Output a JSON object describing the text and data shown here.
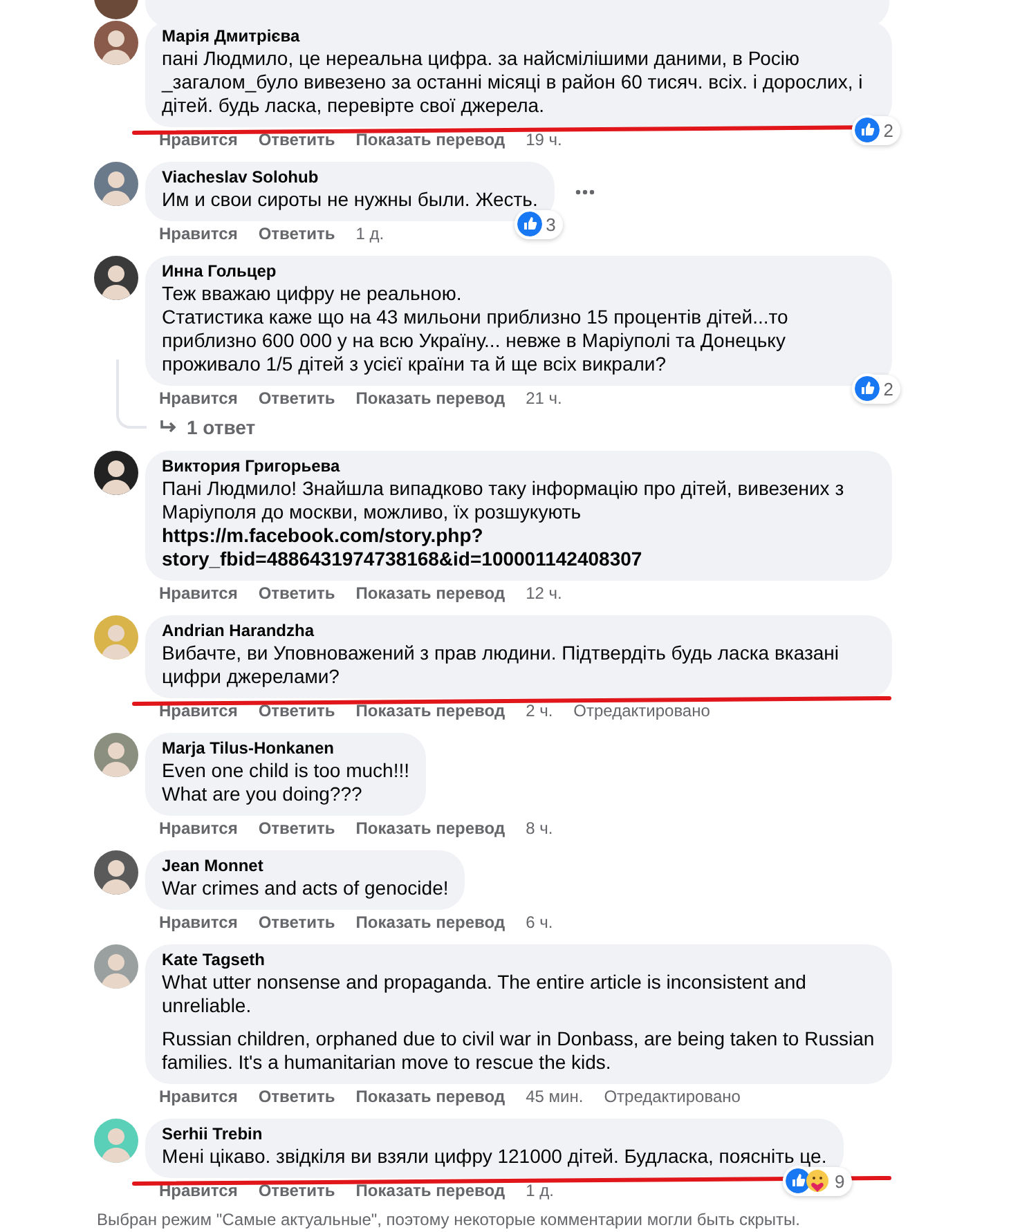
{
  "comments": [
    {
      "author": "Марія Дмитрієва",
      "paragraphs": [
        {
          "kind": "text",
          "text": "пані Людмило, це нереальна цифра. за найсмілішими даними, в Росію _загалом_було вивезено за останні місяці в район 60 тисяч. всіх. і дорослих, і дітей. будь ласка, перевірте свої джерела."
        }
      ],
      "actions": {
        "like": "Нравится",
        "reply": "Ответить",
        "translate": "Показать перевод",
        "time": "19 ч."
      },
      "reactions": {
        "icons": [
          {
            "kind": "like"
          }
        ],
        "count": "2"
      },
      "underlined": true,
      "more_button": false
    },
    {
      "author": "Viacheslav Solohub",
      "paragraphs": [
        {
          "kind": "text",
          "text": "Им и свои сироты не нужны были. Жесть."
        }
      ],
      "actions": {
        "like": "Нравится",
        "reply": "Ответить",
        "time": "1 д."
      },
      "reactions": {
        "icons": [
          {
            "kind": "like"
          }
        ],
        "count": "3"
      },
      "underlined": false,
      "more_button": true
    },
    {
      "author": "Инна Гольцер",
      "paragraphs": [
        {
          "kind": "text",
          "text": "Теж вважаю цифру не реальною."
        },
        {
          "kind": "text",
          "text": "Статистика каже що на 43 мильони приблизно 15 процентів дітей...то приблизно 600 000 у на всю Україну... невже в Маріуполі та Донецьку проживало 1/5 дітей з усієї країни та й ще всіх викрали?"
        }
      ],
      "actions": {
        "like": "Нравится",
        "reply": "Ответить",
        "translate": "Показать перевод",
        "time": "21 ч."
      },
      "reactions": {
        "icons": [
          {
            "kind": "like"
          }
        ],
        "count": "2"
      },
      "replies": "1 ответ",
      "underlined": false,
      "more_button": false
    },
    {
      "author": "Виктория Григорьева",
      "paragraphs": [
        {
          "kind": "text",
          "text": "Пані Людмило! Знайшла випадково таку інформацію про дітей, вивезених з Маріуполя до москви, можливо, їх розшукують"
        },
        {
          "kind": "link",
          "lines": [
            "https://m.facebook.com/story.php?",
            "story_fbid=4886431974738168&id=100001142408307"
          ]
        }
      ],
      "actions": {
        "like": "Нравится",
        "reply": "Ответить",
        "translate": "Показать перевод",
        "time": "12 ч."
      },
      "underlined": false,
      "more_button": false
    },
    {
      "author": "Andrian Harandzha",
      "paragraphs": [
        {
          "kind": "text",
          "text": "Вибачте, ви Уповноважений з прав людини. Підтвердіть будь ласка вказані цифри джерелами?"
        }
      ],
      "actions": {
        "like": "Нравится",
        "reply": "Ответить",
        "translate": "Показать перевод",
        "time": "2 ч.",
        "edited": "Отредактировано"
      },
      "underlined": true,
      "more_button": false
    },
    {
      "author": "Marja Tilus-Honkanen",
      "paragraphs": [
        {
          "kind": "text",
          "text": "Even one child is too much!!!"
        },
        {
          "kind": "text",
          "text": "What are you doing???"
        }
      ],
      "actions": {
        "like": "Нравится",
        "reply": "Ответить",
        "translate": "Показать перевод",
        "time": "8 ч."
      },
      "underlined": false,
      "more_button": false
    },
    {
      "author": "Jean Monnet",
      "paragraphs": [
        {
          "kind": "text",
          "text": "War crimes and acts of genocide!"
        }
      ],
      "actions": {
        "like": "Нравится",
        "reply": "Ответить",
        "translate": "Показать перевод",
        "time": "6 ч."
      },
      "underlined": false,
      "more_button": false
    },
    {
      "author": "Kate Tagseth",
      "paragraphs": [
        {
          "kind": "text",
          "text": "What utter nonsense and propaganda. The entire article is inconsistent and unreliable."
        },
        {
          "kind": "gap",
          "text": "Russian children, orphaned due to civil war in Donbass, are being taken to Russian families. It's a humanitarian move to rescue the kids."
        }
      ],
      "actions": {
        "like": "Нравится",
        "reply": "Ответить",
        "translate": "Показать перевод",
        "time": "45 мин.",
        "edited": "Отредактировано"
      },
      "underlined": false,
      "more_button": false
    },
    {
      "author": "Serhii Trebin",
      "paragraphs": [
        {
          "kind": "text",
          "text": "Мені цікаво. звідкіля ви взяли цифру 121000 дітей. Будласка, поясніть це."
        }
      ],
      "actions": {
        "like": "Нравится",
        "reply": "Ответить",
        "translate": "Показать перевод",
        "time": "1 д."
      },
      "reactions": {
        "icons": [
          {
            "kind": "like"
          },
          {
            "kind": "care"
          }
        ],
        "count": "9"
      },
      "underlined": true,
      "more_button": false
    }
  ],
  "footer": "Выбран режим \"Самые актуальные\", поэтому некоторые комментарии могли быть скрыты."
}
